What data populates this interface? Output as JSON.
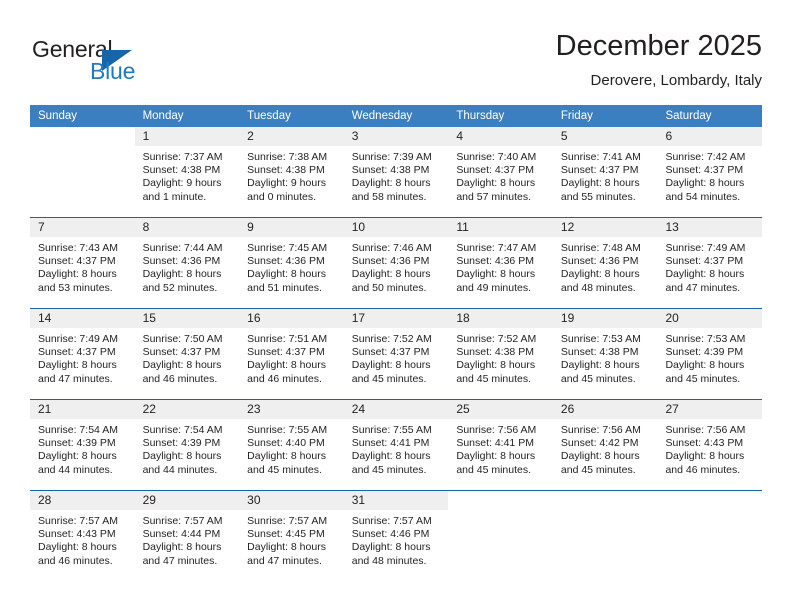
{
  "brand": {
    "name_part1": "General",
    "name_part2": "Blue",
    "triangle_icon": "brand-triangle-icon"
  },
  "header": {
    "title": "December 2025",
    "subtitle": "Derovere, Lombardy, Italy"
  },
  "colors": {
    "header_blue": "#3c7fc0",
    "rule_blue": "#1665ab",
    "brand_blue": "#1f7ac4",
    "daynum_band": "#efeff0",
    "text": "#231f20"
  },
  "weekdays": [
    "Sunday",
    "Monday",
    "Tuesday",
    "Wednesday",
    "Thursday",
    "Friday",
    "Saturday"
  ],
  "weeks": [
    {
      "days": [
        {
          "num": "",
          "lines": [],
          "empty": true
        },
        {
          "num": "1",
          "lines": [
            "Sunrise: 7:37 AM",
            "Sunset: 4:38 PM",
            "Daylight: 9 hours",
            "and 1 minute."
          ]
        },
        {
          "num": "2",
          "lines": [
            "Sunrise: 7:38 AM",
            "Sunset: 4:38 PM",
            "Daylight: 9 hours",
            "and 0 minutes."
          ]
        },
        {
          "num": "3",
          "lines": [
            "Sunrise: 7:39 AM",
            "Sunset: 4:38 PM",
            "Daylight: 8 hours",
            "and 58 minutes."
          ]
        },
        {
          "num": "4",
          "lines": [
            "Sunrise: 7:40 AM",
            "Sunset: 4:37 PM",
            "Daylight: 8 hours",
            "and 57 minutes."
          ]
        },
        {
          "num": "5",
          "lines": [
            "Sunrise: 7:41 AM",
            "Sunset: 4:37 PM",
            "Daylight: 8 hours",
            "and 55 minutes."
          ]
        },
        {
          "num": "6",
          "lines": [
            "Sunrise: 7:42 AM",
            "Sunset: 4:37 PM",
            "Daylight: 8 hours",
            "and 54 minutes."
          ]
        }
      ]
    },
    {
      "days": [
        {
          "num": "7",
          "lines": [
            "Sunrise: 7:43 AM",
            "Sunset: 4:37 PM",
            "Daylight: 8 hours",
            "and 53 minutes."
          ]
        },
        {
          "num": "8",
          "lines": [
            "Sunrise: 7:44 AM",
            "Sunset: 4:36 PM",
            "Daylight: 8 hours",
            "and 52 minutes."
          ]
        },
        {
          "num": "9",
          "lines": [
            "Sunrise: 7:45 AM",
            "Sunset: 4:36 PM",
            "Daylight: 8 hours",
            "and 51 minutes."
          ]
        },
        {
          "num": "10",
          "lines": [
            "Sunrise: 7:46 AM",
            "Sunset: 4:36 PM",
            "Daylight: 8 hours",
            "and 50 minutes."
          ]
        },
        {
          "num": "11",
          "lines": [
            "Sunrise: 7:47 AM",
            "Sunset: 4:36 PM",
            "Daylight: 8 hours",
            "and 49 minutes."
          ]
        },
        {
          "num": "12",
          "lines": [
            "Sunrise: 7:48 AM",
            "Sunset: 4:36 PM",
            "Daylight: 8 hours",
            "and 48 minutes."
          ]
        },
        {
          "num": "13",
          "lines": [
            "Sunrise: 7:49 AM",
            "Sunset: 4:37 PM",
            "Daylight: 8 hours",
            "and 47 minutes."
          ]
        }
      ]
    },
    {
      "days": [
        {
          "num": "14",
          "lines": [
            "Sunrise: 7:49 AM",
            "Sunset: 4:37 PM",
            "Daylight: 8 hours",
            "and 47 minutes."
          ]
        },
        {
          "num": "15",
          "lines": [
            "Sunrise: 7:50 AM",
            "Sunset: 4:37 PM",
            "Daylight: 8 hours",
            "and 46 minutes."
          ]
        },
        {
          "num": "16",
          "lines": [
            "Sunrise: 7:51 AM",
            "Sunset: 4:37 PM",
            "Daylight: 8 hours",
            "and 46 minutes."
          ]
        },
        {
          "num": "17",
          "lines": [
            "Sunrise: 7:52 AM",
            "Sunset: 4:37 PM",
            "Daylight: 8 hours",
            "and 45 minutes."
          ]
        },
        {
          "num": "18",
          "lines": [
            "Sunrise: 7:52 AM",
            "Sunset: 4:38 PM",
            "Daylight: 8 hours",
            "and 45 minutes."
          ]
        },
        {
          "num": "19",
          "lines": [
            "Sunrise: 7:53 AM",
            "Sunset: 4:38 PM",
            "Daylight: 8 hours",
            "and 45 minutes."
          ]
        },
        {
          "num": "20",
          "lines": [
            "Sunrise: 7:53 AM",
            "Sunset: 4:39 PM",
            "Daylight: 8 hours",
            "and 45 minutes."
          ]
        }
      ]
    },
    {
      "days": [
        {
          "num": "21",
          "lines": [
            "Sunrise: 7:54 AM",
            "Sunset: 4:39 PM",
            "Daylight: 8 hours",
            "and 44 minutes."
          ]
        },
        {
          "num": "22",
          "lines": [
            "Sunrise: 7:54 AM",
            "Sunset: 4:39 PM",
            "Daylight: 8 hours",
            "and 44 minutes."
          ]
        },
        {
          "num": "23",
          "lines": [
            "Sunrise: 7:55 AM",
            "Sunset: 4:40 PM",
            "Daylight: 8 hours",
            "and 45 minutes."
          ]
        },
        {
          "num": "24",
          "lines": [
            "Sunrise: 7:55 AM",
            "Sunset: 4:41 PM",
            "Daylight: 8 hours",
            "and 45 minutes."
          ]
        },
        {
          "num": "25",
          "lines": [
            "Sunrise: 7:56 AM",
            "Sunset: 4:41 PM",
            "Daylight: 8 hours",
            "and 45 minutes."
          ]
        },
        {
          "num": "26",
          "lines": [
            "Sunrise: 7:56 AM",
            "Sunset: 4:42 PM",
            "Daylight: 8 hours",
            "and 45 minutes."
          ]
        },
        {
          "num": "27",
          "lines": [
            "Sunrise: 7:56 AM",
            "Sunset: 4:43 PM",
            "Daylight: 8 hours",
            "and 46 minutes."
          ]
        }
      ]
    },
    {
      "days": [
        {
          "num": "28",
          "lines": [
            "Sunrise: 7:57 AM",
            "Sunset: 4:43 PM",
            "Daylight: 8 hours",
            "and 46 minutes."
          ]
        },
        {
          "num": "29",
          "lines": [
            "Sunrise: 7:57 AM",
            "Sunset: 4:44 PM",
            "Daylight: 8 hours",
            "and 47 minutes."
          ]
        },
        {
          "num": "30",
          "lines": [
            "Sunrise: 7:57 AM",
            "Sunset: 4:45 PM",
            "Daylight: 8 hours",
            "and 47 minutes."
          ]
        },
        {
          "num": "31",
          "lines": [
            "Sunrise: 7:57 AM",
            "Sunset: 4:46 PM",
            "Daylight: 8 hours",
            "and 48 minutes."
          ]
        },
        {
          "num": "",
          "lines": [],
          "empty": true
        },
        {
          "num": "",
          "lines": [],
          "empty": true
        },
        {
          "num": "",
          "lines": [],
          "empty": true
        }
      ]
    }
  ]
}
